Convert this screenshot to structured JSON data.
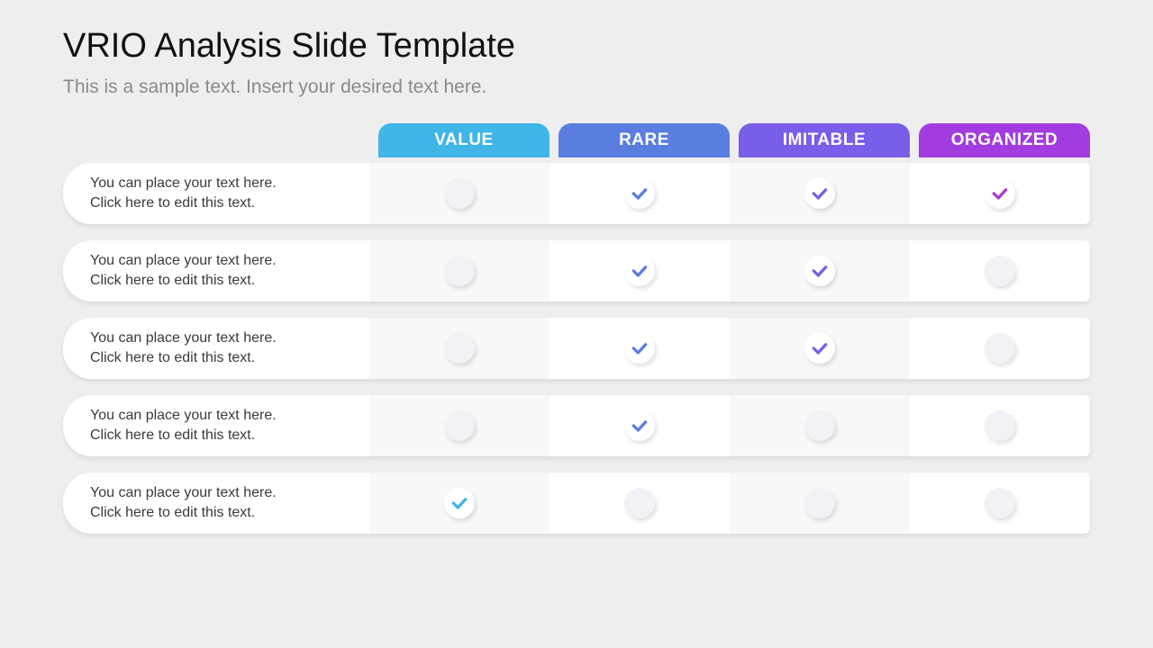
{
  "title": "VRIO Analysis Slide Template",
  "subtitle": "This is a sample text. Insert your desired text here.",
  "columns": [
    {
      "label": "VALUE",
      "color": "#3fb5e8",
      "check_color": "#3fb5e8"
    },
    {
      "label": "RARE",
      "color": "#5a7de0",
      "check_color": "#5a7de0"
    },
    {
      "label": "IMITABLE",
      "color": "#7a5de8",
      "check_color": "#7a5de8"
    },
    {
      "label": "ORGANIZED",
      "color": "#a23be0",
      "check_color": "#a23be0"
    }
  ],
  "rows": [
    {
      "line1": "You can place your text here.",
      "line2": "Click here to edit this text.",
      "checks": [
        false,
        true,
        true,
        true
      ]
    },
    {
      "line1": "You can place your text here.",
      "line2": "Click here to edit this text.",
      "checks": [
        false,
        true,
        true,
        false
      ]
    },
    {
      "line1": "You can place your text here.",
      "line2": "Click here to edit this text.",
      "checks": [
        false,
        true,
        true,
        false
      ]
    },
    {
      "line1": "You can place your text here.",
      "line2": "Click here to edit this text.",
      "checks": [
        false,
        true,
        false,
        false
      ]
    },
    {
      "line1": "You can place your text here.",
      "line2": "Click here to edit this text.",
      "checks": [
        true,
        false,
        false,
        false
      ]
    }
  ]
}
